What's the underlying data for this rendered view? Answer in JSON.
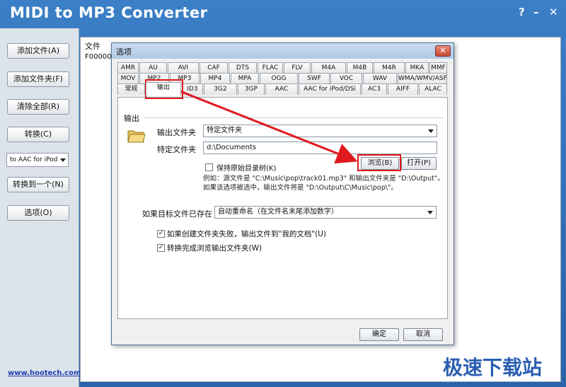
{
  "app": {
    "title": "MIDI to MP3 Converter",
    "help": "?",
    "minimize": "–",
    "close": "✕"
  },
  "sidebar": {
    "buttons": [
      "添加文件(A)",
      "添加文件夹(F)",
      "清除全部(R)",
      "转换(C)",
      "转换到一个(N)",
      "选项(O)"
    ],
    "format_select": "to AAC for iPod",
    "link": "www.hootech.com"
  },
  "list": {
    "column": "文件",
    "file": "F000000"
  },
  "watermark": "极速下载站",
  "dialog": {
    "title": "选项",
    "close": "✕",
    "tabs_row1": [
      "AMR",
      "AU",
      "AVI",
      "CAF",
      "DTS",
      "FLAC",
      "FLV",
      "M4A",
      "M4B",
      "M4R",
      "MKA",
      "MMF"
    ],
    "tabs_row2": [
      "MOV",
      "MP2",
      "MP3",
      "MP4",
      "MPA",
      "OGG",
      "SWF",
      "VOC",
      "WAV",
      "WMA/WMV/ASF"
    ],
    "tabs_row3": [
      "常规",
      "输出",
      "ID3",
      "3G2",
      "3GP",
      "AAC",
      "AAC for iPod/DSi",
      "AC3",
      "AIFF",
      "ALAC"
    ],
    "section": "输出",
    "output_folder_label": "输出文件夹",
    "output_folder_value": "特定文件夹",
    "specific_folder_label": "特定文件夹",
    "specific_folder_value": "d:\\Documents",
    "browse": "浏览(B)",
    "open": "打开(P)",
    "keep_tree": "保持原始目录树(K)",
    "example_line1": "例如：源文件是 \"C:\\Music\\pop\\track01.mp3\" 和输出文件夹是 \"D:\\Output\"。",
    "example_line2": "如果该选项被选中，输出文件将是 \"D:\\Output\\C\\Music\\pop\\\"。",
    "exists_label": "如果目标文件已存在",
    "exists_value": "自动重命名（在文件名末尾添加数字）",
    "fail_mydocs": "如果创建文件夹失败，输出文件到\"我的文档\"(U)",
    "browse_after": "转换完成浏览输出文件夹(W)",
    "ok": "确定",
    "cancel": "取消",
    "check_mark": "✓"
  }
}
